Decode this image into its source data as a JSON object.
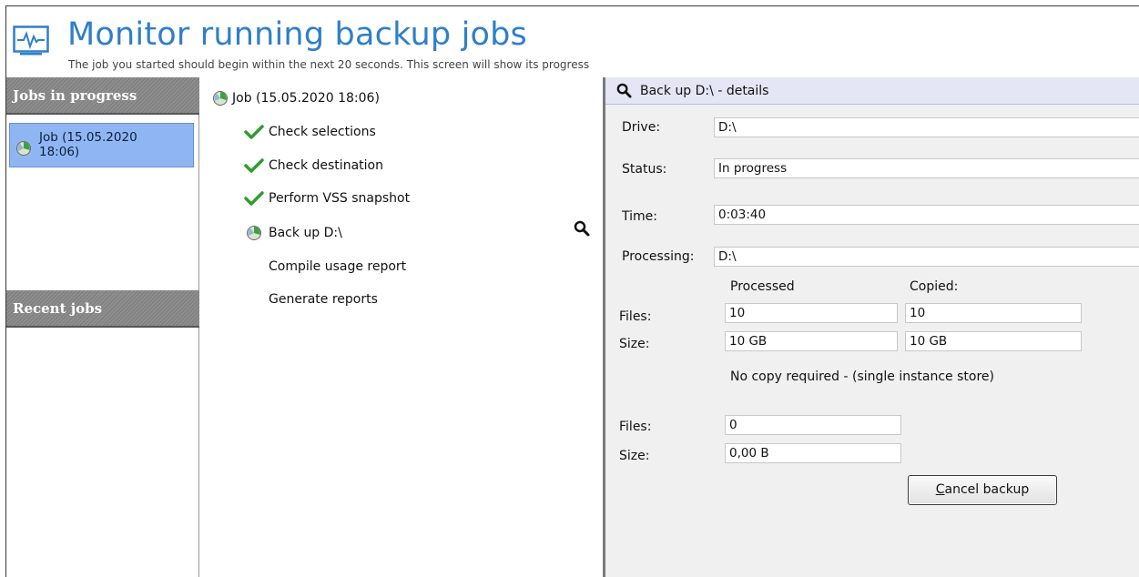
{
  "header": {
    "title": "Monitor running backup jobs",
    "subtitle": "The job you started should begin within the next 20 seconds.  This screen will show its progress",
    "icon": "monitor-pulse-icon"
  },
  "sidebar": {
    "jobs_heading": "Jobs in progress",
    "job_item_label": "Job (15.05.2020 18:06)",
    "recent_heading": "Recent jobs"
  },
  "tree": {
    "root_label": "Job (15.05.2020 18:06)",
    "steps": [
      {
        "label": "Check selections",
        "state": "done"
      },
      {
        "label": "Check destination",
        "state": "done"
      },
      {
        "label": "Perform VSS snapshot",
        "state": "done"
      },
      {
        "label": "Back up D:\\",
        "state": "running"
      },
      {
        "label": "Compile usage report",
        "state": "pending"
      },
      {
        "label": "Generate reports",
        "state": "pending"
      }
    ]
  },
  "details": {
    "heading": "Back up D:\\ - details",
    "drive_label": "Drive:",
    "drive_value": "D:\\",
    "status_label": "Status:",
    "status_value": "In progress",
    "time_label": "Time:",
    "time_value": "0:03:40",
    "processing_label": "Processing:",
    "processing_value": "D:\\",
    "processed_header": "Processed",
    "copied_header": "Copied:",
    "files_label": "Files:",
    "size_label": "Size:",
    "processed_files": "10",
    "copied_files": "10",
    "processed_size": "10 GB",
    "copied_size": "10 GB",
    "no_copy_note": "No copy required - (single instance store)",
    "sis_files_label": "Files:",
    "sis_size_label": "Size:",
    "sis_files": "0",
    "sis_size": "0,00 B",
    "cancel_button_mnemonic": "C",
    "cancel_button_rest": "ancel backup"
  },
  "colors": {
    "title_blue": "#2f7fc9",
    "selection_blue": "#8fb6f2",
    "check_green": "#2e9e2e",
    "panel_gray": "#f0f0f0"
  }
}
